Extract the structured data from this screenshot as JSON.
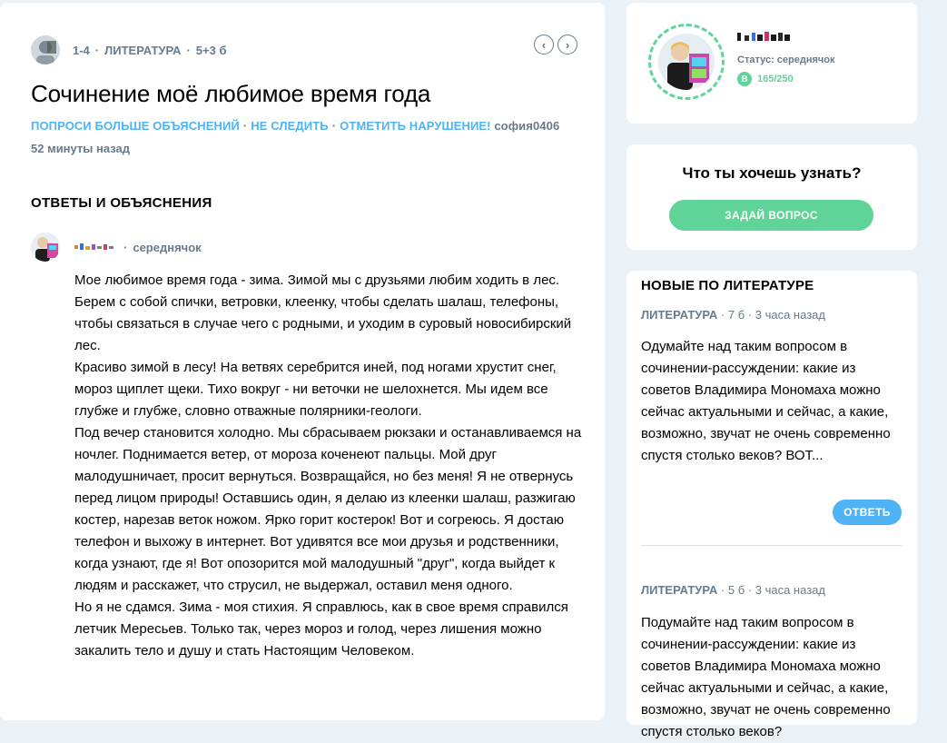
{
  "question": {
    "grade": "1-4",
    "subject": "ЛИТЕРАТУРА",
    "points": "5+3 б",
    "title": "Сочинение моё любимое время года",
    "actions": {
      "more_explanations": "ПОПРОСИ БОЛЬШЕ ОБЪЯСНЕНИЙ",
      "unfollow": "НЕ СЛЕДИТЬ",
      "report": "ОТМЕТИТЬ НАРУШЕНИЕ!"
    },
    "author": "софия0406",
    "time_ago": "52 минуты назад",
    "nav": {
      "prev": "‹",
      "next": "›"
    }
  },
  "answers": {
    "title": "ОТВЕТЫ И ОБЪЯСНЕНИЯ",
    "items": [
      {
        "rank": "середнячок",
        "paragraphs": [
          "Мое любимое время года - зима. Зимой мы с друзьями любим ходить в лес. Берем с собой спички, ветровки, клеенку, чтобы сделать шалаш, телефоны, чтобы связаться в случае чего с родными, и уходим в суровый новосибирский лес.",
          "Красиво зимой в лесу! На ветвях серебрится иней, под ногами хрустит снег, мороз щиплет щеки. Тихо вокруг - ни веточки не шелохнется. Мы идем все глубже и глубже, словно отважные полярники-геологи.",
          "Под вечер становится холодно. Мы сбрасываем рюкзаки и останавливаемся на ночлег. Поднимается ветер, от мороза коченеют пальцы. Мой друг малодушничает, просит вернуться. Возвращайся, но без меня! Я не отвернусь перед лицом природы! Оставшись один, я делаю из клеенки шалаш, разжигаю костер, нарезав веток ножом. Ярко горит костерок! Вот и согреюсь. Я достаю телефон и выхожу в интернет. Вот удивятся все мои друзья и родственники, когда узнают, где я! Вот опозорится мой малодушный \"друг\", когда выйдет к людям и расскажет, что струсил, не выдержал, оставил меня одного.",
          "Но я не сдамся. Зима - моя стихия. Я справлюсь, как в свое время справился летчик Мересьев. Только так, через мороз и голод, через лишения можно закалить тело и душу и стать Настоящим Человеком."
        ]
      }
    ]
  },
  "profile": {
    "status_label": "Статус:",
    "status_value": "середнячок",
    "points_icon": "В",
    "points": "165/250"
  },
  "ask": {
    "title": "Что ты хочешь узнать?",
    "button": "ЗАДАЙ ВОПРОС"
  },
  "new_questions": {
    "title": "НОВЫЕ ПО ЛИТЕРАТУРЕ",
    "items": [
      {
        "subject": "ЛИТЕРАТУРА",
        "points": "7 б",
        "time": "3 часа назад",
        "text": "Одумайте над таким вопросом в сочинении-рассуждении: какие из советов Владимира Мономаха можно сейчас актуальными и сейчас, а какие, возможно, звучат не очень современно спустя столько веков? ВОТ...",
        "reply": "ОТВЕТЬ"
      },
      {
        "subject": "ЛИТЕРАТУРА",
        "points": "5 б",
        "time": "3 часа назад",
        "text": "Подумайте над таким вопросом в сочинении-рассуждении: какие из советов Владимира Мономаха можно сейчас актуальными и сейчас, а какие, возможно, звучат не очень современно спустя столько веков?"
      }
    ]
  },
  "colors": {
    "accent_blue": "#4fb3f6",
    "accent_green": "#60d399",
    "muted": "#687b8c",
    "background": "#ebf2f7"
  }
}
